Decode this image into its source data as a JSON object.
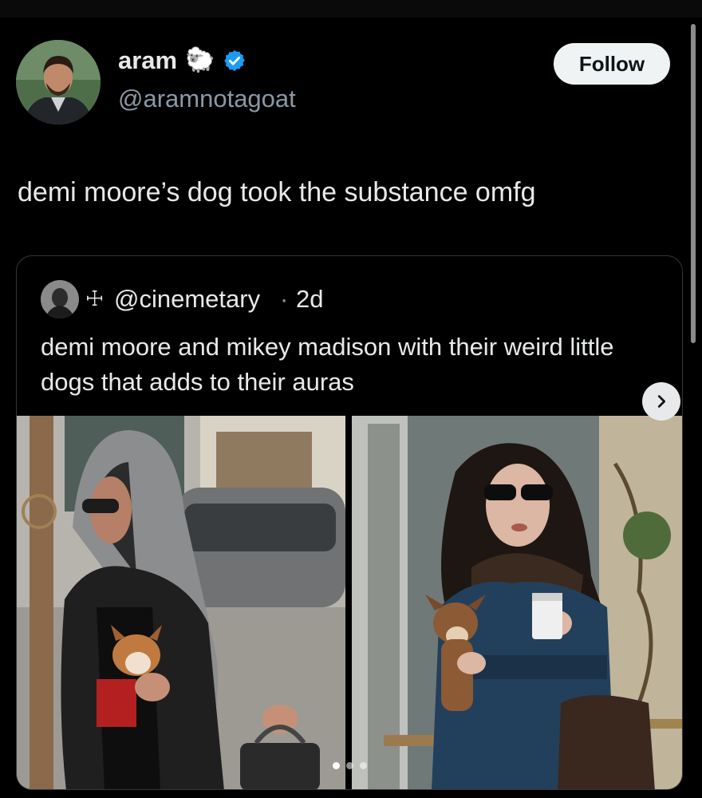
{
  "author": {
    "display_name": "aram",
    "emoji": "🐑",
    "verified_icon": "verified-badge-icon",
    "handle": "@aramnotagoat"
  },
  "follow_label": "Follow",
  "tweet_text": "demi moore’s dog took the substance omfg",
  "quoted": {
    "prefix_symbol": "☩",
    "handle": "@cinemetary",
    "separator": "·",
    "time": "2d",
    "text": "demi moore and mikey madison with their weird little dogs that adds to their auras",
    "next_icon": "chevron-right-icon",
    "photos": [
      "photo-left",
      "photo-right"
    ],
    "pager": {
      "count": 3,
      "active_index": 0
    }
  },
  "colors": {
    "background": "#000000",
    "text": "#e7e9ea",
    "muted": "#8b98a5",
    "verified": "#1d9bf0",
    "border": "#333639"
  }
}
